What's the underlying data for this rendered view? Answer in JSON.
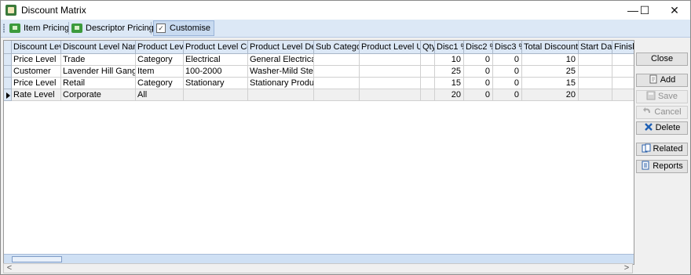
{
  "window": {
    "title": "Discount Matrix",
    "min_glyph": "—",
    "max_glyph": "☐",
    "close_glyph": "✕"
  },
  "toolbar": {
    "item_pricing": "Item Pricing",
    "descriptor_pricing": "Descriptor Pricing",
    "customise": "Customise",
    "customise_checked": "✓"
  },
  "grid": {
    "columns": [
      "Discount Level",
      "Discount Level Name",
      "Product Level",
      "Product Level Code",
      "Product Level Desc",
      "Sub Category",
      "Product Level Unit",
      "Qty",
      "Disc1 %",
      "Disc2 %",
      "Disc3 %",
      "Total Discount %",
      "Start Date",
      "Finish"
    ],
    "rows": [
      [
        "Price Level",
        "Trade",
        "Category",
        "Electrical",
        "General Electrical",
        "",
        "",
        "",
        "10",
        "0",
        "0",
        "10",
        "",
        ""
      ],
      [
        "Customer",
        "Lavender Hill Gang Ltd",
        "Item",
        "100-2000",
        "Washer-Mild Steel...",
        "",
        "",
        "",
        "25",
        "0",
        "0",
        "25",
        "",
        ""
      ],
      [
        "Price Level",
        "Retail",
        "Category",
        "Stationary",
        "Stationary Products",
        "",
        "",
        "",
        "15",
        "0",
        "0",
        "15",
        "",
        ""
      ],
      [
        "Rate Level",
        "Corporate",
        "All",
        "",
        "",
        "",
        "",
        "",
        "20",
        "0",
        "0",
        "20",
        "",
        ""
      ]
    ],
    "selected_row": 3
  },
  "buttons": {
    "close": "Close",
    "add": "Add",
    "save": "Save",
    "cancel": "Cancel",
    "delete": "Delete",
    "related": "Related",
    "reports": "Reports"
  },
  "scroll": {
    "left": "<",
    "right": ">"
  },
  "colors": {
    "header_bg": "#dce8f6",
    "toolbar_bg": "#dce8f6",
    "accent": "#3c9a3c"
  }
}
